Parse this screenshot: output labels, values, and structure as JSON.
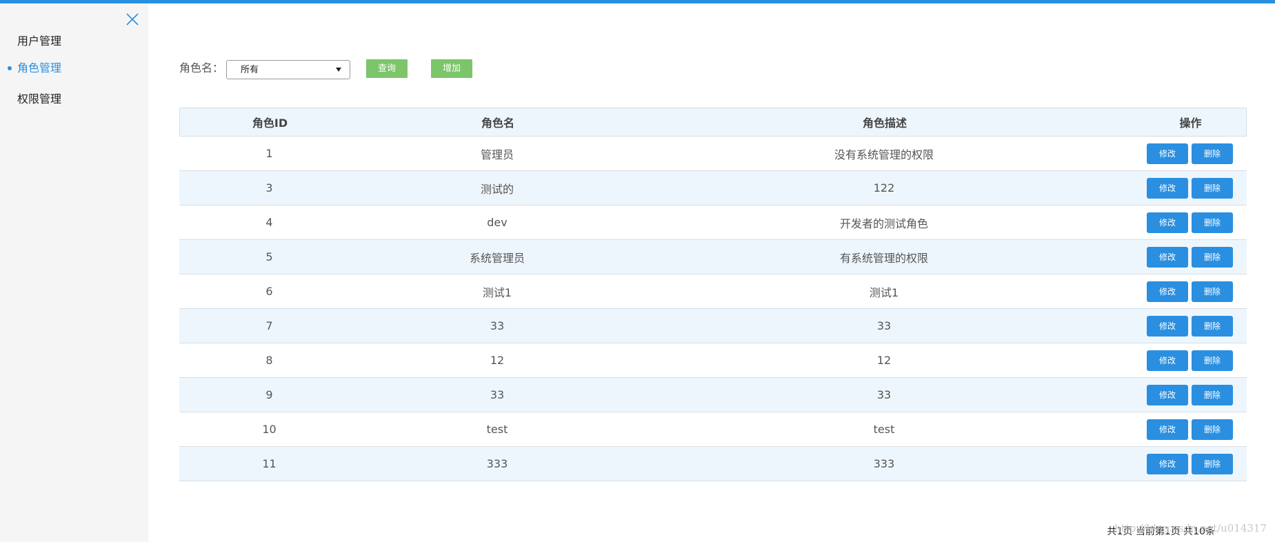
{
  "sidebar": {
    "items": [
      {
        "label": "用户管理",
        "active": false
      },
      {
        "label": "角色管理",
        "active": true
      },
      {
        "label": "权限管理",
        "active": false
      }
    ],
    "close_icon": "close-icon"
  },
  "filter": {
    "label": "角色名：",
    "select_value": "所有",
    "query_label": "查询",
    "add_label": "增加"
  },
  "table": {
    "headers": [
      "角色ID",
      "角色名",
      "角色描述",
      "操作"
    ],
    "rows": [
      {
        "id": "1",
        "name": "管理员",
        "desc": "没有系统管理的权限"
      },
      {
        "id": "3",
        "name": "测试的",
        "desc": "122"
      },
      {
        "id": "4",
        "name": "dev",
        "desc": "开发者的测试角色"
      },
      {
        "id": "5",
        "name": "系统管理员",
        "desc": "有系统管理的权限"
      },
      {
        "id": "6",
        "name": "测试1",
        "desc": "测试1"
      },
      {
        "id": "7",
        "name": "33",
        "desc": "33"
      },
      {
        "id": "8",
        "name": "12",
        "desc": "12"
      },
      {
        "id": "9",
        "name": "33",
        "desc": "33"
      },
      {
        "id": "10",
        "name": "test",
        "desc": "test"
      },
      {
        "id": "11",
        "name": "333",
        "desc": "333"
      }
    ],
    "edit_label": "修改",
    "delete_label": "删除"
  },
  "pager": {
    "text": "共1页  当前第1页  共10条"
  },
  "watermark": {
    "text": "http://blog.csdn.net/u014317"
  },
  "colors": {
    "accent": "#2a8fe0",
    "green_button": "#7cc56a",
    "row_alt": "#eef6fd",
    "sidebar_bg": "#f5f5f5"
  }
}
